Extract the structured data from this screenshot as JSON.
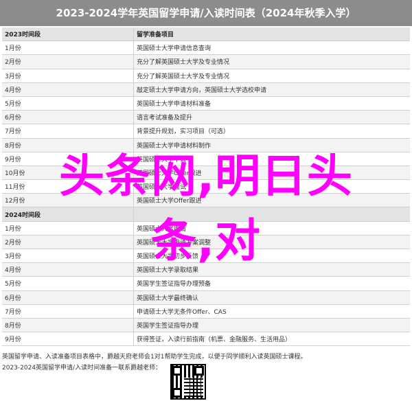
{
  "title": "2023-2024学年英国留学申请/入读时间表（2024年秋季入学）",
  "table": {
    "headers": [
      "2023时间段",
      "留学准备项目"
    ],
    "rows": [
      {
        "time": "1月份",
        "item": "英国硕士大学申请信息查询"
      },
      {
        "time": "2月份",
        "item": "充分了解英国硕士大学及专业情况"
      },
      {
        "time": "3月份",
        "item": "充分了解英国硕士大学及专业情况"
      },
      {
        "time": "4月份",
        "item": "敲定硕士大学申请方向，英国硕士大学选校申请"
      },
      {
        "time": "5月份",
        "item": "英国硕士大学申请材料准备"
      },
      {
        "time": "6月份",
        "item": "语言考试准备及提升"
      },
      {
        "time": "7月份",
        "item": "背景提升规划，实习项目（可选）"
      },
      {
        "time": "8月份",
        "item": "英国硕士大学申请材料制作"
      },
      {
        "time": "9月份",
        "item": "英国硕士大学申请"
      },
      {
        "time": "10月份",
        "item": "英国硕士大学Offer跟进"
      },
      {
        "time": "11月份",
        "item": "英国硕士大学面试"
      },
      {
        "time": "12月份",
        "item": "英国硕士大学Offer跟进"
      }
    ],
    "section2_header": "2024时间段",
    "rows2": [
      {
        "time": "1月份",
        "item": "英国硕士大学申请"
      },
      {
        "time": "2月份",
        "item": "英国硕士大学申请方案调整"
      },
      {
        "time": "3月份",
        "item": "英国硕士大学初步反馈"
      },
      {
        "time": "4月份",
        "item": "英国硕士大学录取结果"
      },
      {
        "time": "5月份",
        "item": "英国学生签证指导办理预备"
      },
      {
        "time": "6月份",
        "item": "英国硕士大学最终确认"
      },
      {
        "time": "7月份",
        "item": "申请硕士大学无条件Offer、CAS"
      },
      {
        "time": "8月份",
        "item": "英国学生签证指导办理"
      },
      {
        "time": "9月份",
        "item": "获得签证，入读行前指南（机票、金融服务、生活用品）"
      }
    ]
  },
  "footnotes": [
    "英国留学申请、入读准备项目表格中，爵越天府老师会1对1帮助学生完成，以便于同学顺利入读英国硕士课程。",
    "2023-2024英国留学申请/入读时间准备一联系爵越老师："
  ],
  "watermark": {
    "line1": "头条网,明日头",
    "line2": "条,对"
  },
  "colors": {
    "title_bg": "#8c8c8c",
    "header_bg": "#e3e3e3",
    "watermark": "#ff00ff"
  }
}
